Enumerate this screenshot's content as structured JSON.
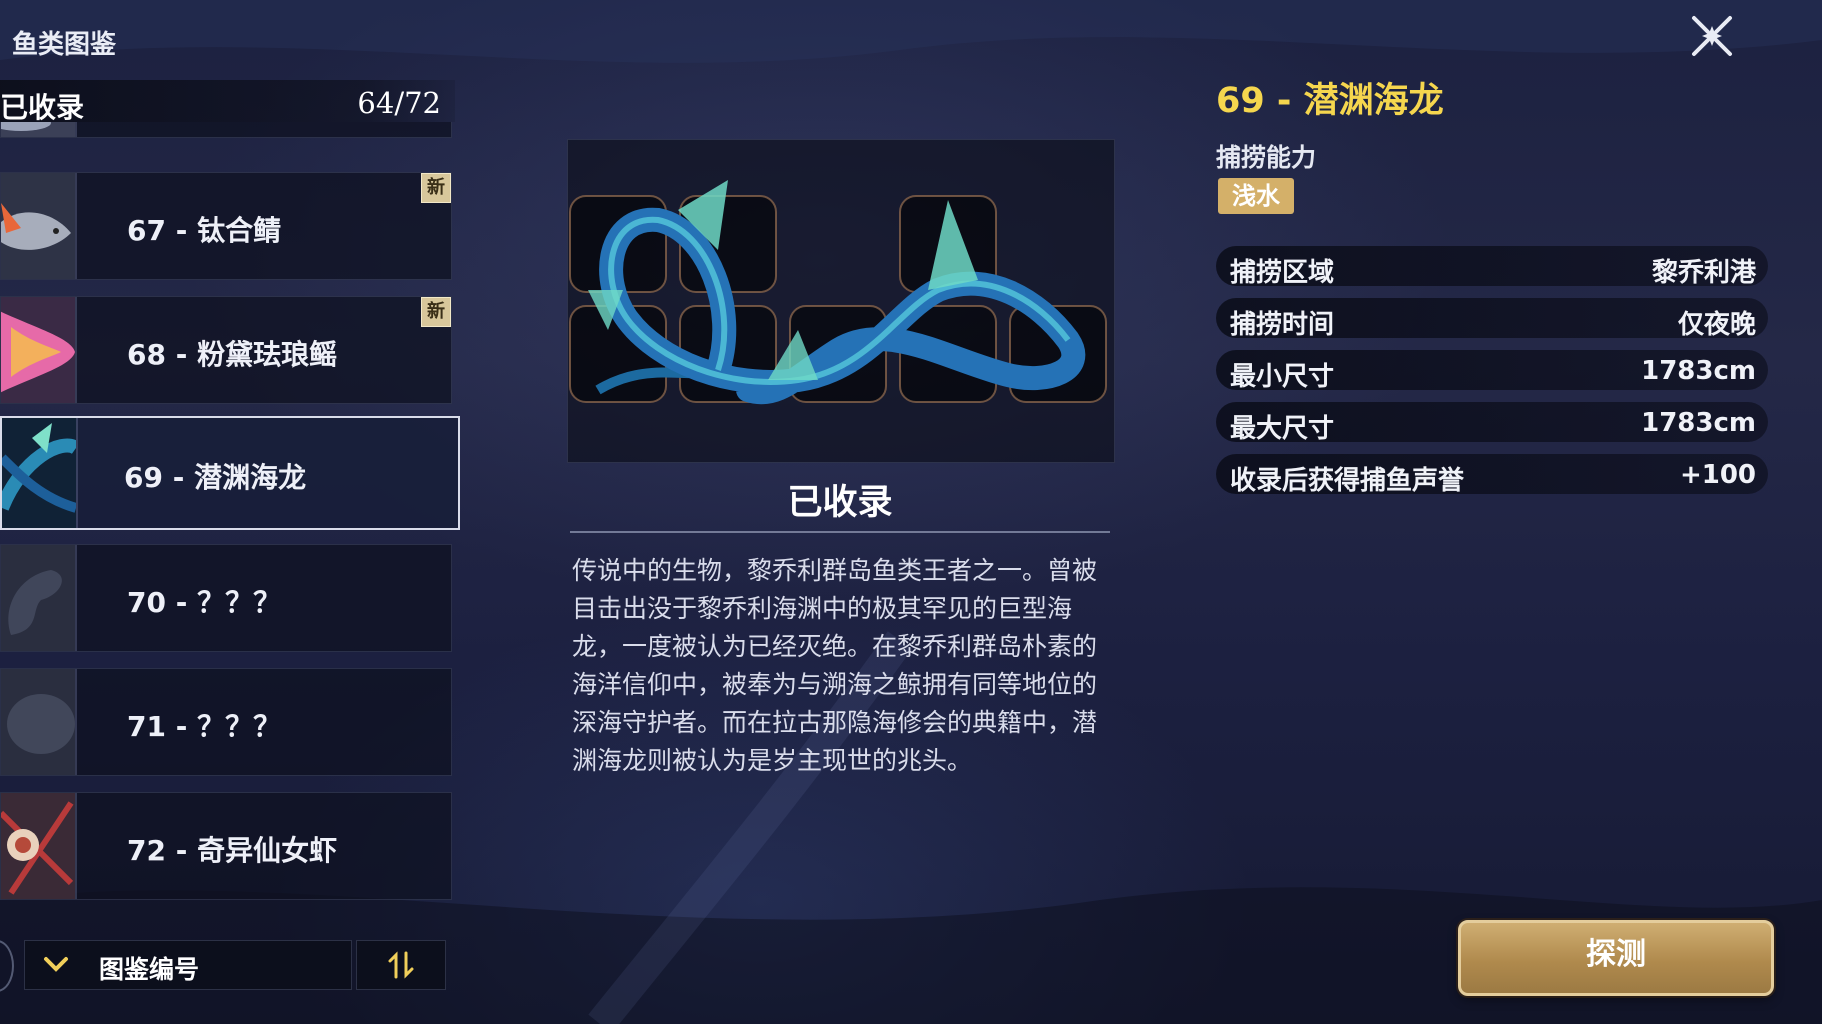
{
  "page": {
    "title": "鱼类图鉴"
  },
  "collection": {
    "label": "已收录",
    "count": "64/72"
  },
  "list": {
    "items": [
      {
        "label": "",
        "new": false
      },
      {
        "label": "67 - 钛合鲭",
        "new": true,
        "badge": "新"
      },
      {
        "label": "68 - 粉黛珐琅鳐",
        "new": true,
        "badge": "新"
      },
      {
        "label": "69 - 潜渊海龙",
        "new": false,
        "selected": true
      },
      {
        "label": "70 - ？？？",
        "new": false
      },
      {
        "label": "71 - ？？？",
        "new": false
      },
      {
        "label": "72 - 奇异仙女虾",
        "new": false
      }
    ]
  },
  "sort": {
    "label": "图鉴编号",
    "order_icon": "sort-order-icon"
  },
  "detail": {
    "status": "已收录",
    "description": "传说中的生物，黎乔利群岛鱼类王者之一。曾被目击出没于黎乔利海渊中的极其罕见的巨型海龙，一度被认为已经灭绝。在黎乔利群岛朴素的海洋信仰中，被奉为与溯海之鲸拥有同等地位的深海守护者。而在拉古那隐海修会的典籍中，潜渊海龙则被认为是岁主现世的兆头。",
    "title": "69 - 潜渊海龙",
    "ability_title": "捕捞能力",
    "ability_tag": "浅水",
    "stats": [
      {
        "name": "捕捞区域",
        "value": "黎乔利港"
      },
      {
        "name": "捕捞时间",
        "value": "仅夜晚"
      },
      {
        "name": "最小尺寸",
        "value": "1783cm"
      },
      {
        "name": "最大尺寸",
        "value": "1783cm"
      },
      {
        "name": "收录后获得捕鱼声誉",
        "value": "+100"
      }
    ]
  },
  "actions": {
    "detect": "探测"
  },
  "colors": {
    "accent": "#f5d64e",
    "tag": "#d4b069",
    "button": "#b08a4d"
  }
}
